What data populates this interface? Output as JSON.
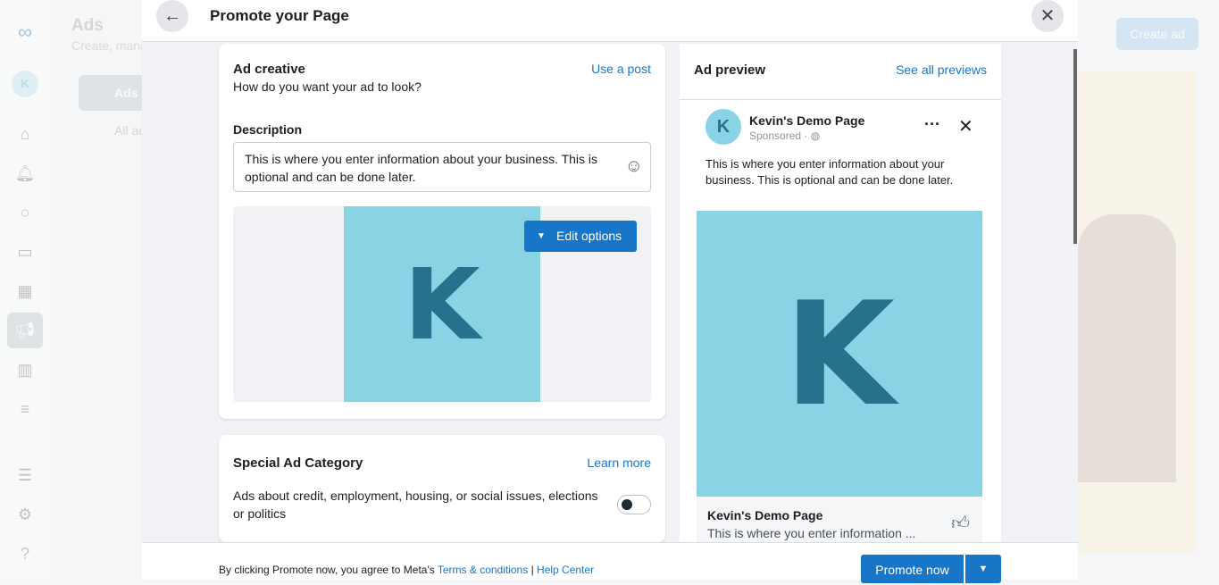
{
  "background": {
    "title": "Ads",
    "subtitle": "Create, mana",
    "nav_active": "Ads s",
    "nav_all": "All ac",
    "create_ad": "Create ad",
    "avatar_letter": "K"
  },
  "modal": {
    "title": "Promote your Page"
  },
  "creative": {
    "title": "Ad creative",
    "subtitle": "How do you want your ad to look?",
    "use_post": "Use a post",
    "description_label": "Description",
    "description_value": "This is where you enter information about your business. This is optional and can be done later.",
    "edit_options": "Edit options",
    "image_letter": "K"
  },
  "special": {
    "title": "Special Ad Category",
    "learn_more": "Learn more",
    "text": "Ads about credit, employment, housing, or social issues, elections or politics",
    "toggle_on": false
  },
  "preview": {
    "title": "Ad preview",
    "see_all": "See all previews",
    "page_name": "Kevin's Demo Page",
    "sponsored": "Sponsored ·",
    "avatar_letter": "K",
    "body": "This is where you enter information about your business. This is optional and can be done later.",
    "image_letter": "K",
    "footer_name": "Kevin's Demo Page",
    "footer_text": "This is where you enter information ..."
  },
  "footer": {
    "agree": "By clicking Promote now, you agree to Meta's ",
    "terms": "Terms & conditions",
    "sep": " | ",
    "help": "Help Center",
    "promote": "Promote now"
  },
  "colors": {
    "accent": "#1876c8",
    "image_bg": "#89d4e4",
    "image_fg": "#26728c"
  }
}
